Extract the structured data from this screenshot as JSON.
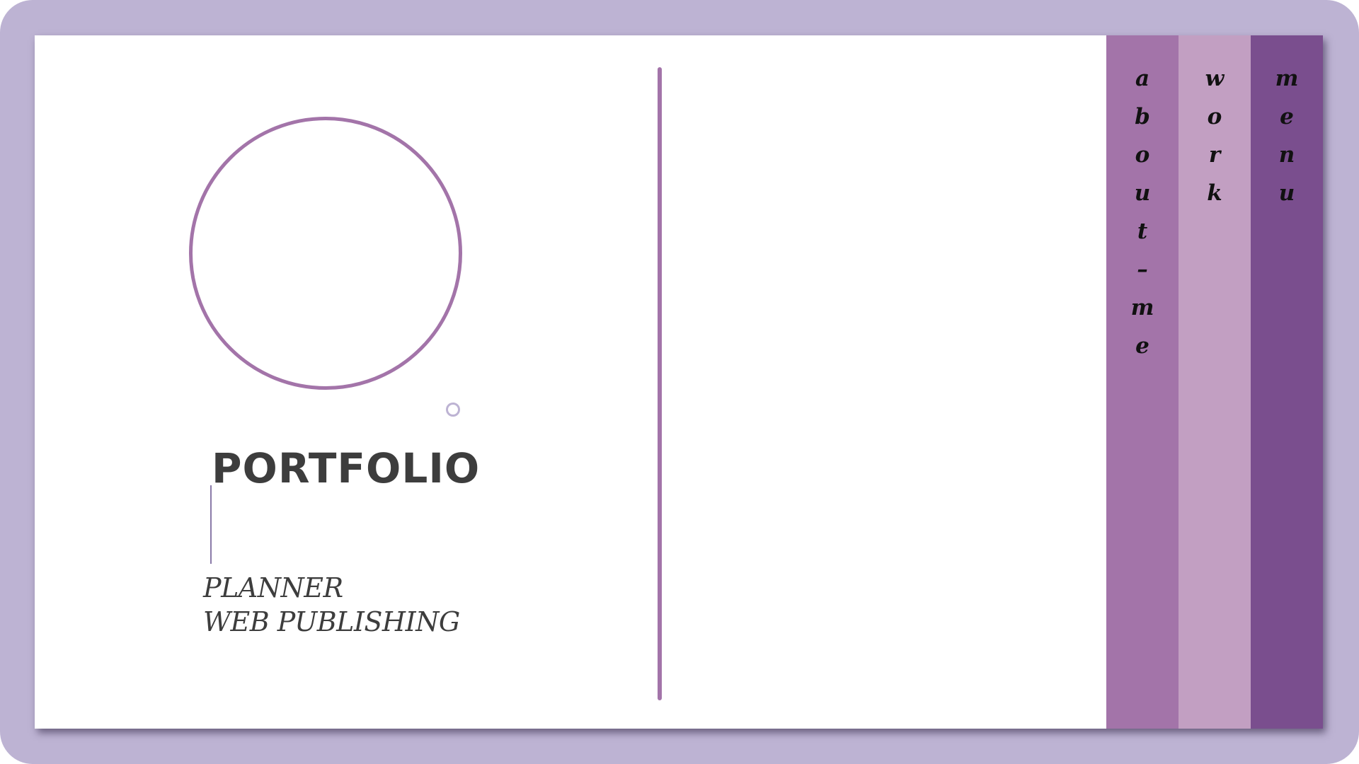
{
  "page": {
    "title": "PORTFOLIO",
    "subtitle_lines": [
      "PLANNER",
      "WEB PUBLISHING"
    ]
  },
  "panels": [
    {
      "label": "about me",
      "letters": [
        "a",
        "b",
        "o",
        "u",
        "t",
        "–",
        "m",
        "e"
      ],
      "color": "#a374a9"
    },
    {
      "label": "work",
      "letters": [
        "w",
        "o",
        "r",
        "k"
      ],
      "color": "#c29fc2"
    },
    {
      "label": "menu",
      "letters": [
        "m",
        "e",
        "n",
        "u"
      ],
      "color": "#7a4e8e"
    }
  ],
  "colors": {
    "frame": "#bdb3d3",
    "accent": "#a374a9",
    "text": "#3d3d3d"
  }
}
